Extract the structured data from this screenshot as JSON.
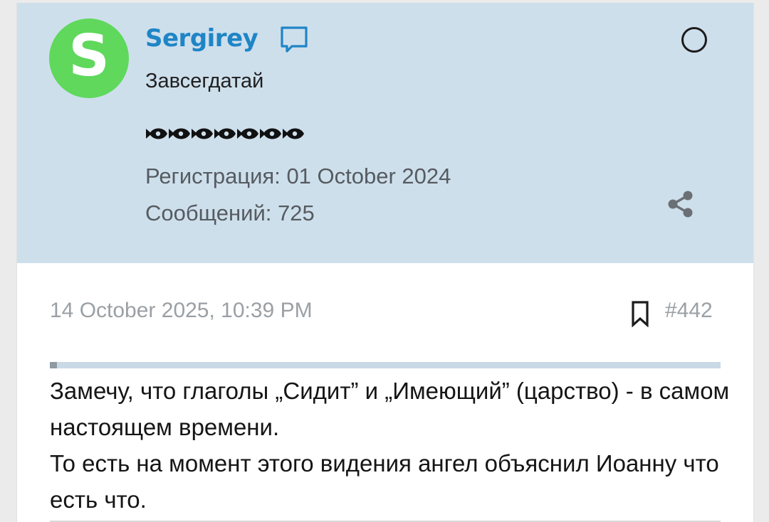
{
  "user": {
    "avatar_letter": "S",
    "username": "Sergirey",
    "title": "Завсегдатай",
    "registration": "Регистрация: 01 October 2024",
    "posts": "Сообщений: 725",
    "rank_icon": "fish-icon",
    "rank_count": 7
  },
  "post": {
    "date": "14 October 2025, 10:39 PM",
    "number": "#442",
    "lines": [
      "Замечу, что глаголы „Сидит” и „Имеющий” (царство) - в самом настоящем времени.",
      "То есть на момент этого видения ангел объяснил Иоанну что есть что."
    ]
  },
  "colors": {
    "panel_bg": "#cedfec",
    "avatar_bg": "#5fd85c",
    "username": "#1f85c6",
    "meta_text": "#555b60",
    "date_text": "#9aa0a5"
  }
}
